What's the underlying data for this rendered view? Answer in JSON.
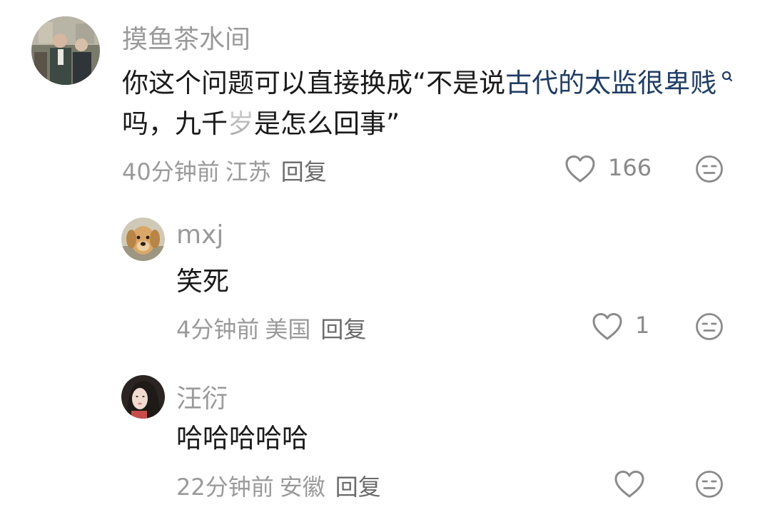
{
  "comments": [
    {
      "username": "摸鱼茶水间",
      "text_prefix": "你这个问题可以直接换成“不是说",
      "link_text": "古代的太监很卑贱",
      "text_mid": "吗，九千",
      "masked_char": "岁",
      "text_suffix": "是怎么回事”",
      "time": "40分钟前",
      "location": "江苏",
      "reply_label": "回复",
      "likes": "166"
    },
    {
      "username": "mxj",
      "text": "笑死",
      "time": "4分钟前",
      "location": "美国",
      "reply_label": "回复",
      "likes": "1"
    },
    {
      "username": "汪衍",
      "text": "哈哈哈哈哈",
      "time": "22分钟前",
      "location": "安徽",
      "reply_label": "回复",
      "likes": ""
    }
  ],
  "colors": {
    "text": "#1a1a1a",
    "muted": "#9a9a9a",
    "link": "#1f3d66",
    "icon": "#8a8a8a"
  },
  "icons": {
    "like": "heart-outline-icon",
    "dislike": "neutral-face-icon",
    "search": "search-icon"
  }
}
